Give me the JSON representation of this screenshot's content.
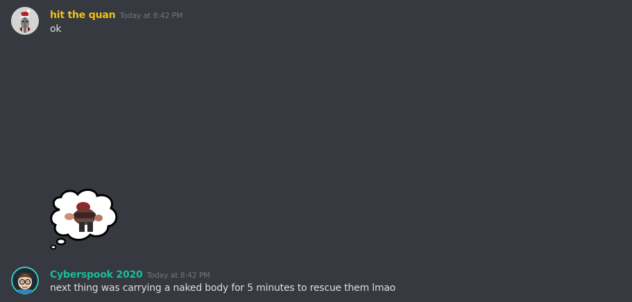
{
  "messages": [
    {
      "author": "hit the quan",
      "author_color": "#f1c40f",
      "timestamp": "Today at 8:42 PM",
      "text": "ok",
      "avatar": "santa-hat-character-avatar"
    },
    {
      "author": "",
      "attachment": "thought-bubble-sticker-image"
    },
    {
      "author": "Cyberspook 2020",
      "author_color": "#1abc9c",
      "timestamp": "Today at 8:42 PM",
      "text": "next thing was carrying a naked body for 5 minutes to rescue them lmao",
      "avatar": "cartoon-glasses-character-avatar"
    }
  ],
  "colors": {
    "background": "#36393f",
    "message_text": "#dcddde",
    "timestamp": "#72767d"
  }
}
